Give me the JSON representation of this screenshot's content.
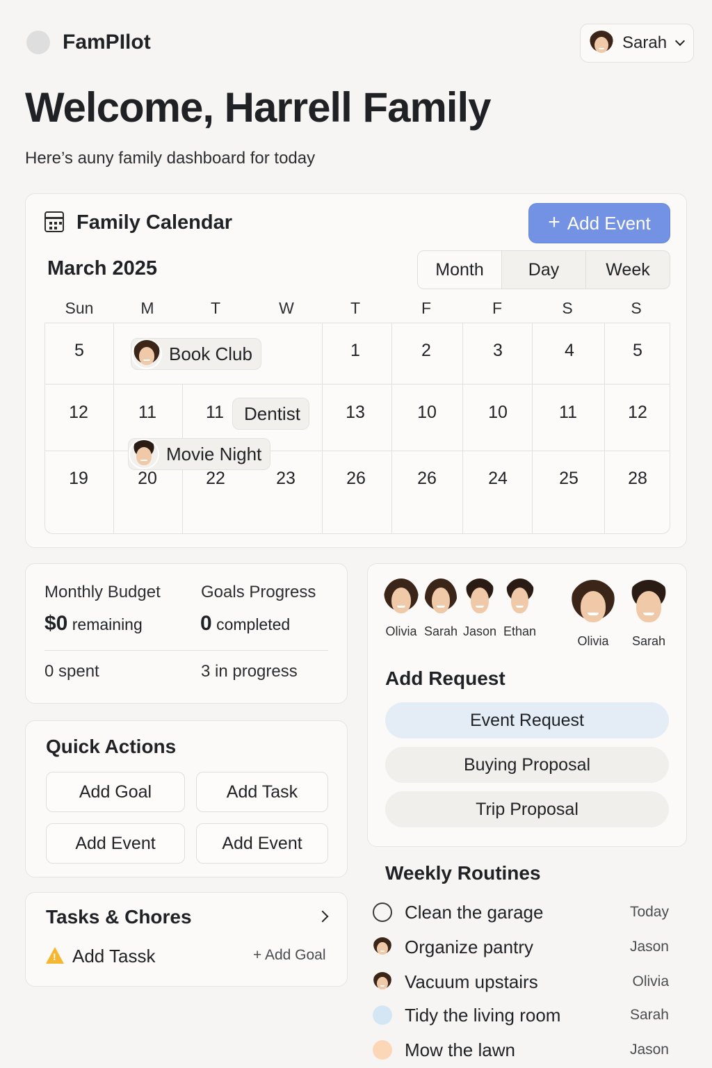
{
  "header": {
    "app_name": "FamPIlot",
    "user_name": "Sarah",
    "welcome": "Welcome, Harrell Family",
    "subtitle": "Here’s auny family dashboard for today"
  },
  "calendar": {
    "title": "Family Calendar",
    "add_event_label": "Add Event",
    "month_label": "March 2025",
    "views": [
      "Month",
      "Day",
      "Week"
    ],
    "weekdays": [
      "Sun",
      "M",
      "T",
      "W",
      "T",
      "F",
      "F",
      "S",
      "S"
    ],
    "rows": [
      [
        "5",
        "",
        "",
        "",
        "1",
        "2",
        "3",
        "4",
        "5"
      ],
      [
        "12",
        "11",
        "11",
        "",
        "13",
        "10",
        "10",
        "11",
        "12"
      ],
      [
        "19",
        "20",
        "22",
        "23",
        "26",
        "26",
        "24",
        "25",
        "28"
      ]
    ],
    "events": {
      "book_club": "Book Club",
      "dentist": "Dentist",
      "movie_night": "Movie Night"
    }
  },
  "budget": {
    "budget_label": "Monthly Budget",
    "budget_amount": "$0",
    "budget_suffix": "remaining",
    "spent": "0 spent",
    "goals_label": "Goals Progress",
    "goals_count": "0",
    "goals_suffix": "completed",
    "in_progress": "3 in progress"
  },
  "quick_actions": {
    "title": "Quick Actions",
    "buttons": [
      "Add Goal",
      "Add Task",
      "Add Event",
      "Add Event"
    ]
  },
  "tasks": {
    "title": "Tasks & Chores",
    "item": "Add Tassk",
    "add_goal": "+ Add Goal"
  },
  "members": {
    "small": [
      "Olivia",
      "Sarah",
      "Jason",
      "Ethan"
    ],
    "large": [
      "Olivia",
      "Sarah"
    ]
  },
  "requests": {
    "title": "Add Request",
    "buttons": [
      "Event Request",
      "Buying Proposal",
      "Trip Proposal"
    ]
  },
  "routines": {
    "title": "Weekly Routines",
    "items": [
      {
        "name": "Clean the garage",
        "who": "Today"
      },
      {
        "name": "Organize pantry",
        "who": "Jason"
      },
      {
        "name": "Vacuum upstairs",
        "who": "Olivia"
      },
      {
        "name": "Tidy the living room",
        "who": "Sarah"
      },
      {
        "name": "Mow the lawn",
        "who": "Jason"
      }
    ]
  },
  "colors": {
    "accent": "#7392e3",
    "background": "#f6f5f3",
    "warning": "#f5b731"
  }
}
